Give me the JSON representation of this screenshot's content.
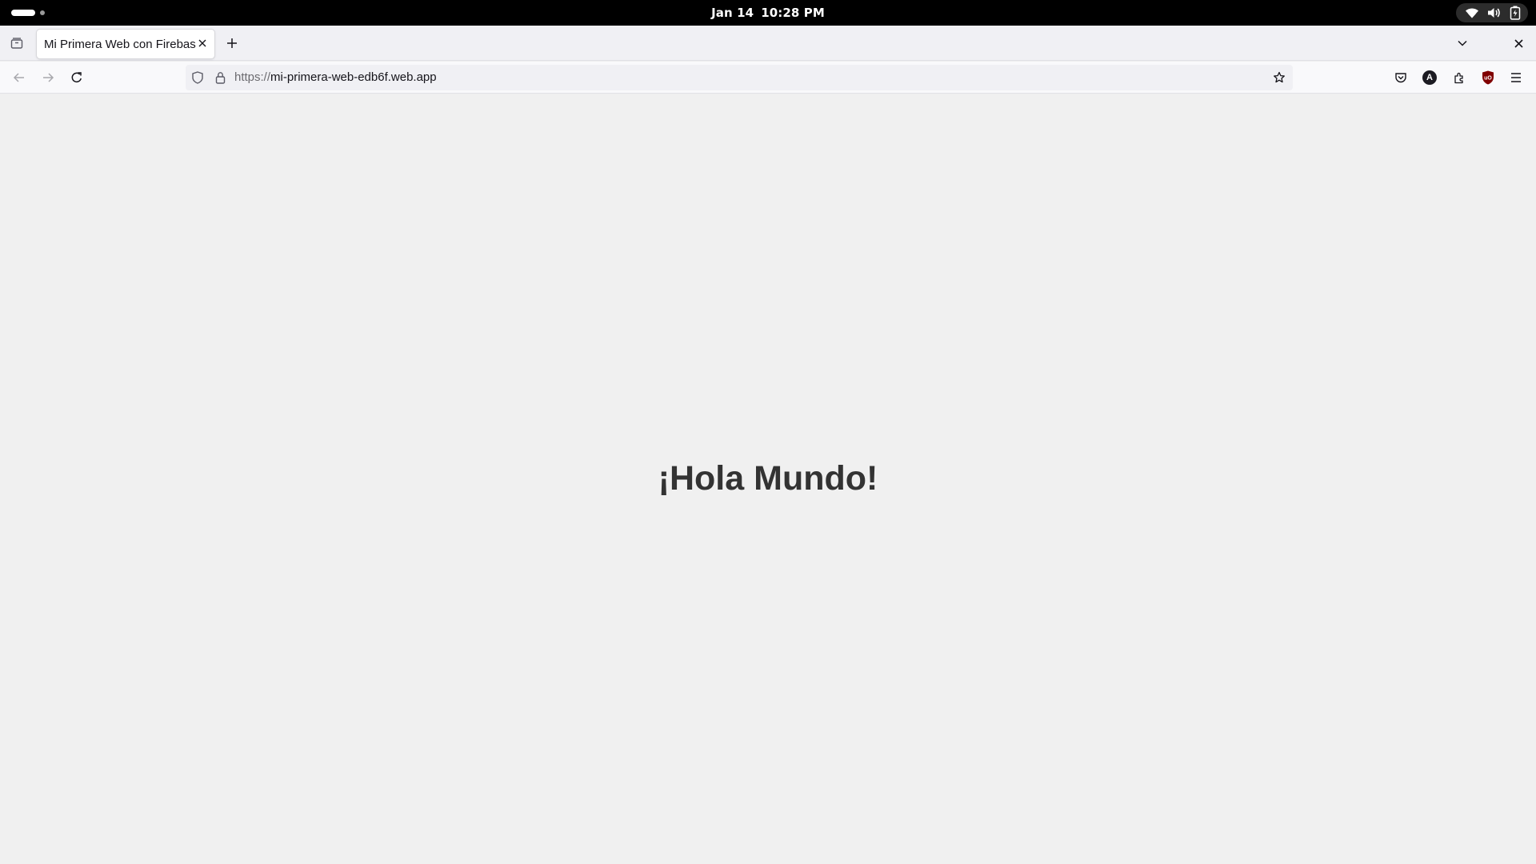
{
  "system_bar": {
    "date": "Jan 14",
    "time": "10:28 PM",
    "icons": [
      "wifi-icon",
      "volume-icon",
      "battery-icon"
    ]
  },
  "browser": {
    "tabs": [
      {
        "title": "Mi Primera Web con Firebase",
        "active": true
      }
    ],
    "address_bar": {
      "scheme": "https://",
      "host_path": "mi-primera-web-edb6f.web.app"
    },
    "toolbar_icons": [
      "pocket-icon",
      "account-icon",
      "extensions-icon",
      "ublock-icon",
      "menu-icon"
    ],
    "account_initial": "A",
    "ublock_label": "uO"
  },
  "page": {
    "heading": "¡Hola Mundo!",
    "background": "#f0f0f0",
    "heading_color": "#333333"
  }
}
